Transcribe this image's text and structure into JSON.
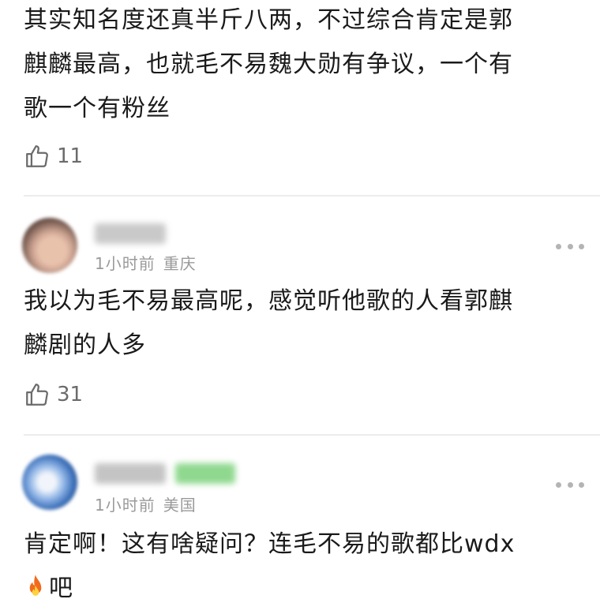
{
  "comments": [
    {
      "text_lines": [
        "其实知名度还真半斤八两，不过综合肯定是郭",
        "麒麟最高，也就毛不易魏大勋有争议，一个有",
        "歌一个有粉丝"
      ],
      "likes": "11"
    },
    {
      "time": "1小时前",
      "location": "重庆",
      "text_lines": [
        "我以为毛不易最高呢，感觉听他歌的人看郭麒",
        "麟剧的人多"
      ],
      "likes": "31"
    },
    {
      "time": "1小时前",
      "location": "美国",
      "text_lines": [
        "肯定啊！这有啥疑问？连毛不易的歌都比wdx"
      ],
      "last_line_suffix": "吧"
    }
  ],
  "icons": {
    "like": "thumbs-up-outline-icon",
    "more": "more-dots-icon",
    "emoji": "fire-emoji-icon"
  },
  "colors": {
    "text": "#1a1a1a",
    "meta": "#9a9a9a",
    "divider": "#ececec",
    "badge_blur": "#8fd88f"
  }
}
